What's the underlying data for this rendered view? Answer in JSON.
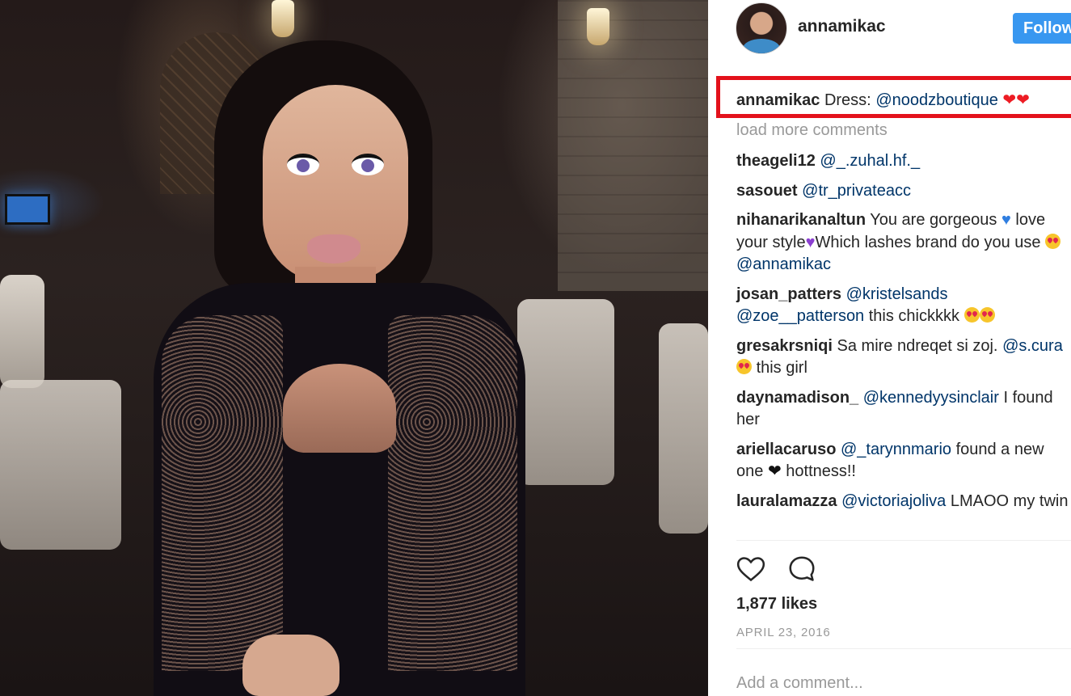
{
  "post": {
    "username": "annamikac",
    "follow_label": "Follow",
    "caption_user": "annamikac",
    "caption_text": "Dress:",
    "caption_mention": "@noodzboutique",
    "caption_hearts": "❤❤",
    "load_more": "load more comments",
    "likes": "1,877 likes",
    "date": "APRIL 23, 2016",
    "add_comment_placeholder": "Add a comment..."
  },
  "comments": [
    {
      "user": "theageli12",
      "mention": "@_.zuhal.hf._"
    },
    {
      "user": "sasouet",
      "mention": "@tr_privateacc"
    },
    {
      "user": "nihanarikanaltun",
      "text1": "You are gorgeous",
      "text2": "love your style",
      "text3": "Which lashes brand do you use",
      "mention": "@annamikac"
    },
    {
      "user": "josan_patters",
      "mention": "@kristelsands",
      "mention2": "@zoe__patterson",
      "text": "this chickkkk"
    },
    {
      "user": "gresakrsniqi",
      "text": "Sa mire ndreqet si zoj.",
      "mention": "@s.cura",
      "text2": "this girl"
    },
    {
      "user": "daynamadison_",
      "mention": "@kennedyysinclair",
      "text": "I found her"
    },
    {
      "user": "ariellacaruso",
      "mention": "@_tarynnmario",
      "text": "found a new one",
      "text2": "hottness!!"
    },
    {
      "user": "lauralamazza",
      "mention": "@victoriajoliva",
      "text": "LMAOO my twin"
    }
  ],
  "icons": {
    "like": "heart-outline-icon",
    "comment": "comment-bubble-icon"
  },
  "colors": {
    "follow_button": "#3897f0",
    "highlight_box": "#e3111b",
    "mention": "#003569"
  }
}
